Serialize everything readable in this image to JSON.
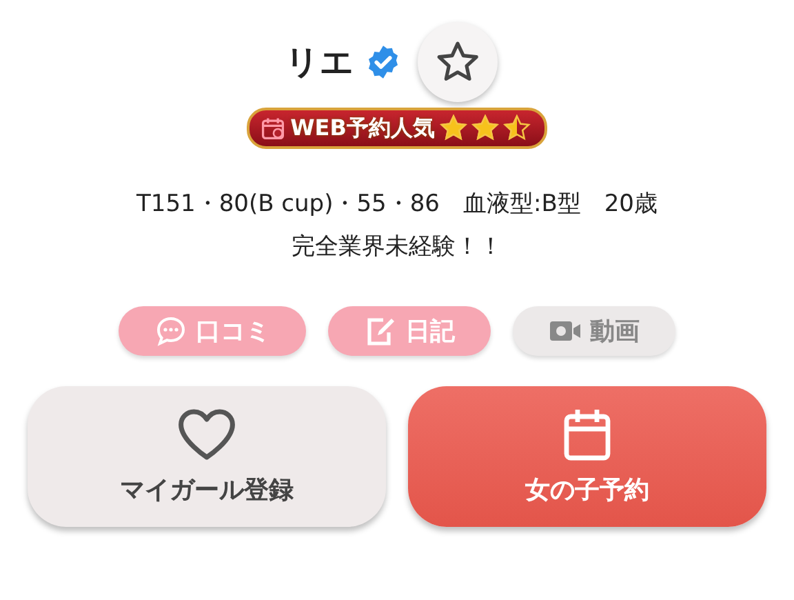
{
  "profile": {
    "name": "リエ",
    "verified": true,
    "favorite": false
  },
  "badge": {
    "label": "WEB予約人気",
    "stars": 2.5
  },
  "stats": "T151・80(B cup)・55・86　血液型:B型　20歳",
  "catchphrase": "完全業界未経験！！",
  "links": [
    {
      "kind": "review",
      "label": "口コミ",
      "disabled": false
    },
    {
      "kind": "diary",
      "label": "日記",
      "disabled": false
    },
    {
      "kind": "video",
      "label": "動画",
      "disabled": true
    }
  ],
  "actions": [
    {
      "kind": "favorite",
      "label": "マイガール登録"
    },
    {
      "kind": "reserve",
      "label": "女の子予約"
    }
  ]
}
